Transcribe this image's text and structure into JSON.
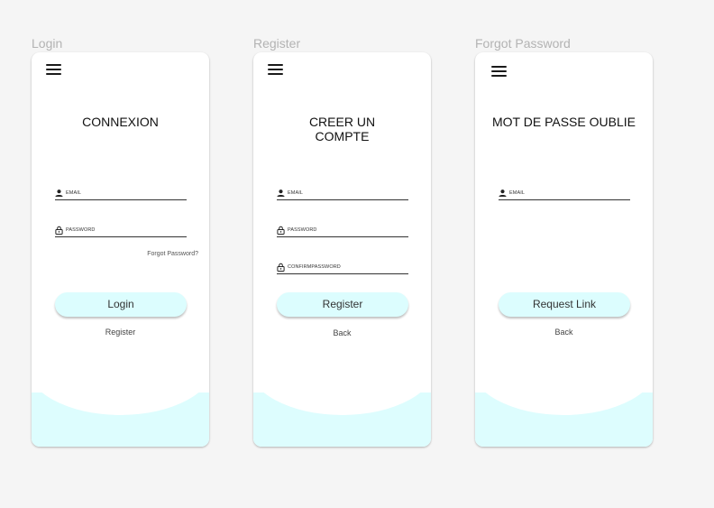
{
  "colors": {
    "canvas": "#f5f5f5",
    "card": "#ffffff",
    "accent": "#ddfdfe",
    "frame_label": "#b3b3b3"
  },
  "login": {
    "frame_label": "Login",
    "menu_icon": "hamburger-menu-icon",
    "title": "CONNEXION",
    "email_label": "EMAIL",
    "password_label": "PASSWORD",
    "forgot_link": "Forgot Password?",
    "button_label": "Login",
    "secondary_link": "Register"
  },
  "register": {
    "frame_label": "Register",
    "menu_icon": "hamburger-menu-icon",
    "title_line1": "CREER UN",
    "title_line2": "COMPTE",
    "email_label": "EMAIL",
    "password_label": "PASSWORD",
    "confirm_label": "CONFIRMPASSWORD",
    "button_label": "Register",
    "secondary_link": "Back"
  },
  "forgot": {
    "frame_label": "Forgot Password",
    "menu_icon": "hamburger-menu-icon",
    "title": "MOT DE PASSE OUBLIE",
    "email_label": "EMAIL",
    "button_label": "Request Link",
    "secondary_link": "Back"
  }
}
